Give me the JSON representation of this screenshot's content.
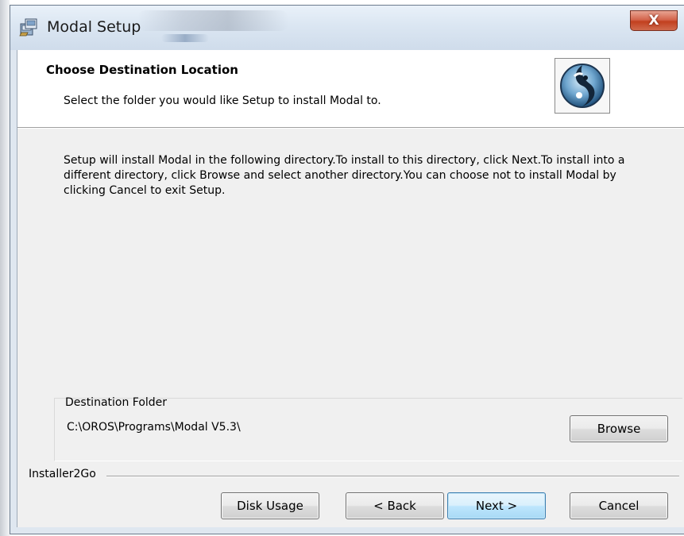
{
  "window": {
    "title": "Modal Setup",
    "close_glyph": "X"
  },
  "header": {
    "title": "Choose Destination Location",
    "subtitle": "Select the folder you would like Setup to install Modal to."
  },
  "body": {
    "text": "Setup will install Modal in the following directory.To install to this directory, click Next.To install into a different directory, click Browse and select another directory.You can choose not to install Modal by clicking Cancel to exit Setup."
  },
  "destination": {
    "label": "Destination Folder",
    "path": "C:\\OROS\\Programs\\Modal V5.3\\",
    "browse_label": "Browse"
  },
  "footer": {
    "brand": "Installer2Go",
    "disk_usage_label": "Disk Usage",
    "back_label": "< Back",
    "next_label": "Next >",
    "cancel_label": "Cancel"
  },
  "icons": {
    "app": "installer-package-icon",
    "logo": "modal-logo-icon",
    "close": "close-icon"
  },
  "colors": {
    "close_button": "#c2401f",
    "default_button_border": "#3c7fb1",
    "dialog_background": "#f0f0f0",
    "header_background": "#ffffff"
  }
}
